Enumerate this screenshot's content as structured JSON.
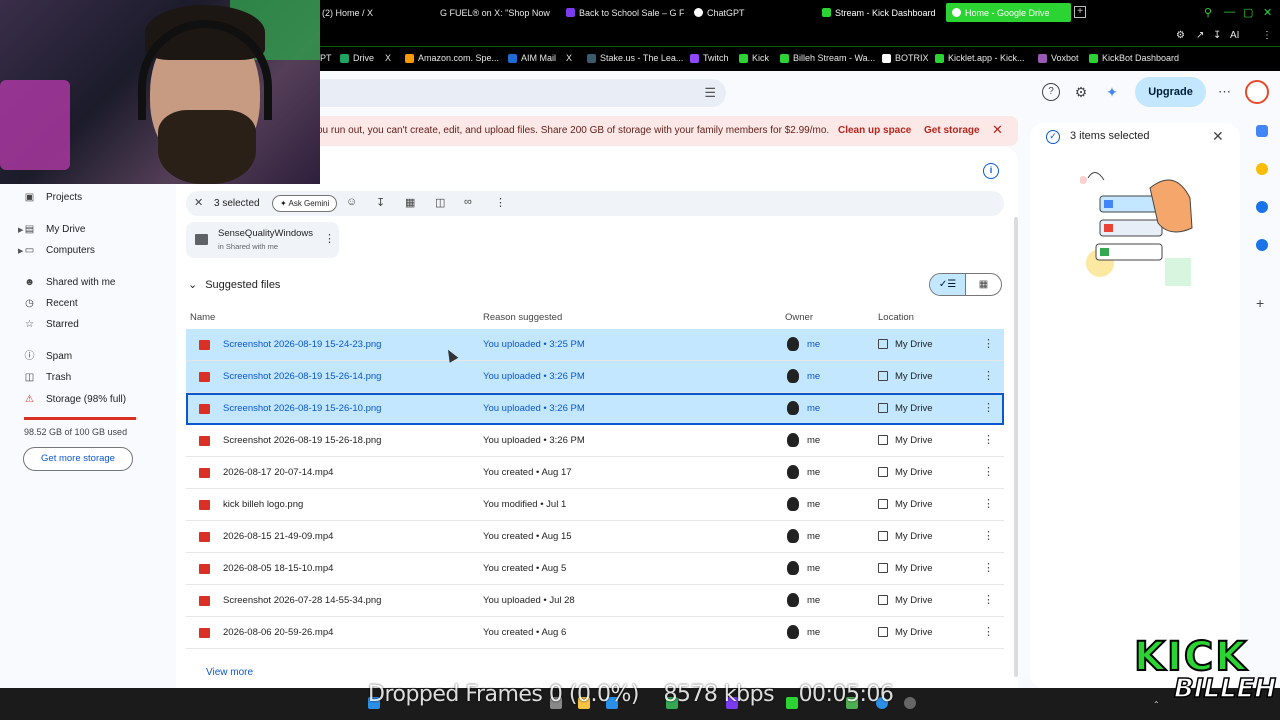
{
  "browser": {
    "tabs": [
      {
        "label": "(2) Home / X",
        "color": "#000000"
      },
      {
        "label": "G FUEL® on X: \"Shop Now",
        "color": "#000000"
      },
      {
        "label": "Back to School Sale – G FU",
        "color": "#7b3cf0"
      },
      {
        "label": "ChatGPT",
        "color": "#ffffff"
      },
      {
        "label": "Stream - Kick Dashboard",
        "color": "#2bd432"
      },
      {
        "label": "Home - Google Drive",
        "color": "#2bd432"
      }
    ],
    "ai_label": "AI",
    "bookmarks": [
      {
        "label": "PT",
        "color": "#888888"
      },
      {
        "label": "Drive",
        "color": "#1fa463"
      },
      {
        "label": "X",
        "color": "#ffffff"
      },
      {
        "label": "Amazon.com. Spe...",
        "color": "#ff9900"
      },
      {
        "label": "AIM Mail",
        "color": "#1e6bd6"
      },
      {
        "label": "X",
        "color": "#ffffff"
      },
      {
        "label": "Stake.us - The Lea...",
        "color": "#1a2c38"
      },
      {
        "label": "Twitch",
        "color": "#9146ff"
      },
      {
        "label": "Kick",
        "color": "#2bd432"
      },
      {
        "label": "Billeh Stream - Wa...",
        "color": "#2bd432"
      },
      {
        "label": "BOTRIX",
        "color": "#ffffff"
      },
      {
        "label": "Kicklet.app - Kick...",
        "color": "#2bd432"
      },
      {
        "label": "Voxbot",
        "color": "#9b59b6"
      },
      {
        "label": "KickBot Dashboard",
        "color": "#2bd432"
      }
    ]
  },
  "header": {
    "upgrade_label": "Upgrade"
  },
  "banner": {
    "message": "ou run out, you can't create, edit, and upload files. Share 200 GB of storage with your family members for $2.99/mo.",
    "cleanup_label": "Clean up space",
    "get_storage_label": "Get storage"
  },
  "sidebar": {
    "items": [
      {
        "label": "Projects",
        "icon": "projects-icon"
      },
      {
        "label": "My Drive",
        "icon": "my-drive-icon"
      },
      {
        "label": "Computers",
        "icon": "computers-icon"
      },
      {
        "label": "Shared with me",
        "icon": "shared-icon"
      },
      {
        "label": "Recent",
        "icon": "clock-icon"
      },
      {
        "label": "Starred",
        "icon": "star-icon"
      },
      {
        "label": "Spam",
        "icon": "spam-icon"
      },
      {
        "label": "Trash",
        "icon": "trash-icon"
      },
      {
        "label": "Storage (98% full)",
        "icon": "warning-icon"
      }
    ],
    "storage_used_fraction": 0.985,
    "storage_text": "98.52 GB of 100 GB used",
    "get_more_label": "Get more storage"
  },
  "selection": {
    "count_label": "3 selected",
    "ask_gemini_label": "Ask Gemini"
  },
  "folder": {
    "name": "SenseQualityWindows",
    "subtitle": "in Shared with me"
  },
  "suggested": {
    "heading": "Suggested files",
    "columns": [
      "Name",
      "Reason suggested",
      "Owner",
      "Location"
    ],
    "rows": [
      {
        "name": "Screenshot 2026-08-19 15-24-23.png",
        "reason": "You uploaded • 3:25 PM",
        "owner": "me",
        "location": "My Drive",
        "selected": true
      },
      {
        "name": "Screenshot 2026-08-19 15-26-14.png",
        "reason": "You uploaded • 3:26 PM",
        "owner": "me",
        "location": "My Drive",
        "selected": true
      },
      {
        "name": "Screenshot 2026-08-19 15-26-10.png",
        "reason": "You uploaded • 3:26 PM",
        "owner": "me",
        "location": "My Drive",
        "selected": true
      },
      {
        "name": "Screenshot 2026-08-19 15-26-18.png",
        "reason": "You uploaded • 3:26 PM",
        "owner": "me",
        "location": "My Drive",
        "selected": false
      },
      {
        "name": "2026-08-17 20-07-14.mp4",
        "reason": "You created • Aug 17",
        "owner": "me",
        "location": "My Drive",
        "selected": false
      },
      {
        "name": "kick billeh logo.png",
        "reason": "You modified • Jul 1",
        "owner": "me",
        "location": "My Drive",
        "selected": false
      },
      {
        "name": "2026-08-15 21-49-09.mp4",
        "reason": "You created • Aug 15",
        "owner": "me",
        "location": "My Drive",
        "selected": false
      },
      {
        "name": "2026-08-05 18-15-10.mp4",
        "reason": "You created • Aug 5",
        "owner": "me",
        "location": "My Drive",
        "selected": false
      },
      {
        "name": "Screenshot 2026-07-28 14-55-34.png",
        "reason": "You uploaded • Jul 28",
        "owner": "me",
        "location": "My Drive",
        "selected": false
      },
      {
        "name": "2026-08-06 20-59-26.mp4",
        "reason": "You created • Aug 6",
        "owner": "me",
        "location": "My Drive",
        "selected": false
      }
    ],
    "view_more_label": "View more"
  },
  "details_panel": {
    "title": "3 items selected"
  },
  "stream_overlay": {
    "dropped_frames": "Dropped Frames 0 (0.0%)",
    "bitrate": "8578 kbps",
    "duration": "00:05:06",
    "logo_top": "KICK",
    "logo_bottom": "BILLEH"
  }
}
